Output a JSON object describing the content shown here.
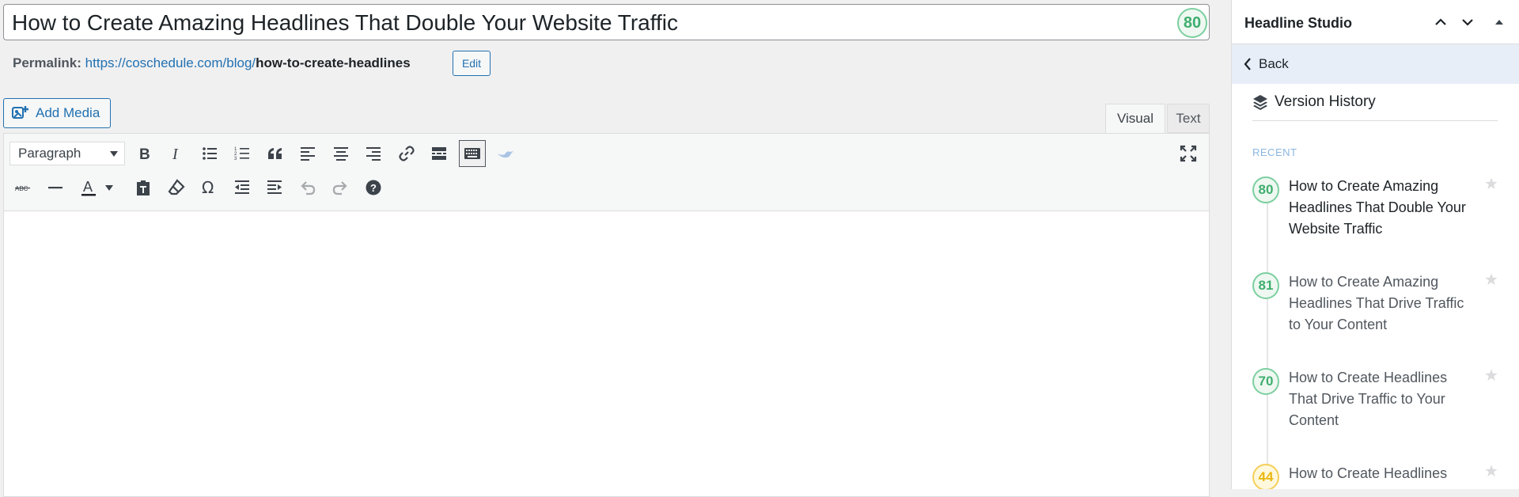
{
  "editor": {
    "title": "How to Create Amazing Headlines That Double Your Website Traffic",
    "title_score": "80",
    "permalink_label": "Permalink:",
    "permalink_base": "https://coschedule.com/blog/",
    "permalink_slug": "how-to-create-headlines",
    "edit_label": "Edit",
    "add_media_label": "Add Media",
    "tabs": {
      "visual": "Visual",
      "text": "Text"
    },
    "format_select": "Paragraph",
    "toolbar_row1": [
      "bold-icon",
      "italic-icon",
      "bullet-list-icon",
      "numbered-list-icon",
      "blockquote-icon",
      "align-left-icon",
      "align-center-icon",
      "align-right-icon",
      "link-icon",
      "read-more-icon",
      "toolbar-toggle-icon",
      "bird-icon",
      "fullscreen-icon"
    ],
    "toolbar_row2": [
      "strikethrough-icon",
      "horizontal-line-icon",
      "text-color-icon",
      "paste-text-icon",
      "clear-formatting-icon",
      "special-character-icon",
      "outdent-icon",
      "indent-icon",
      "undo-icon",
      "redo-icon",
      "help-icon"
    ]
  },
  "sidebar": {
    "title": "Headline Studio",
    "back_label": "Back",
    "version_history_label": "Version History",
    "recent_label": "RECENT",
    "versions": [
      {
        "score": "80",
        "headline": "How to Create Amazing Headlines That Double Your Website Traffic",
        "color": "green",
        "current": true
      },
      {
        "score": "81",
        "headline": "How to Create Amazing Headlines That Drive Traffic to Your Content",
        "color": "green",
        "current": false
      },
      {
        "score": "70",
        "headline": "How to Create Headlines That Drive Traffic to Your Content",
        "color": "green",
        "current": false
      },
      {
        "score": "44",
        "headline": "How to Create Headlines",
        "color": "yellow",
        "current": false
      }
    ]
  },
  "colors": {
    "accent": "#2271b1",
    "score_green": "#3fae6f",
    "score_yellow": "#e8b710",
    "back_bg": "#e8eef8"
  }
}
